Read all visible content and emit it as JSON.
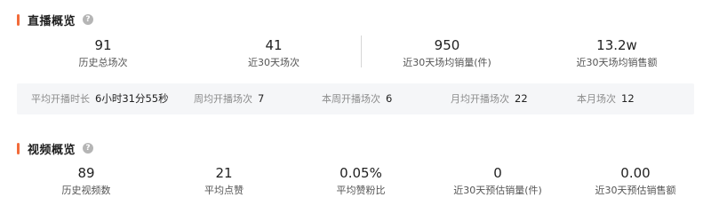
{
  "live": {
    "title": "直播概览",
    "help_icon": "question-circle-icon",
    "accent_color": "#f26b3a",
    "stats": [
      {
        "value": "91",
        "label": "历史总场次"
      },
      {
        "value": "41",
        "label": "近30天场次"
      },
      {
        "value": "950",
        "label": "近30天场均销量(件)"
      },
      {
        "value": "13.2w",
        "label": "近30天场均销售额"
      }
    ],
    "summary": [
      {
        "label": "平均开播时长",
        "value": "6小时31分55秒"
      },
      {
        "label": "周均开播场次",
        "value": "7"
      },
      {
        "label": "本周开播场次",
        "value": "6"
      },
      {
        "label": "月均开播场次",
        "value": "22"
      },
      {
        "label": "本月场次",
        "value": "12"
      }
    ]
  },
  "video": {
    "title": "视频概览",
    "help_icon": "question-circle-icon",
    "stats": [
      {
        "value": "89",
        "label": "历史视频数"
      },
      {
        "value": "21",
        "label": "平均点赞"
      },
      {
        "value": "0.05%",
        "label": "平均赞粉比"
      },
      {
        "value": "0",
        "label": "近30天预估销量(件)"
      },
      {
        "value": "0.00",
        "label": "近30天预估销售额"
      }
    ]
  }
}
